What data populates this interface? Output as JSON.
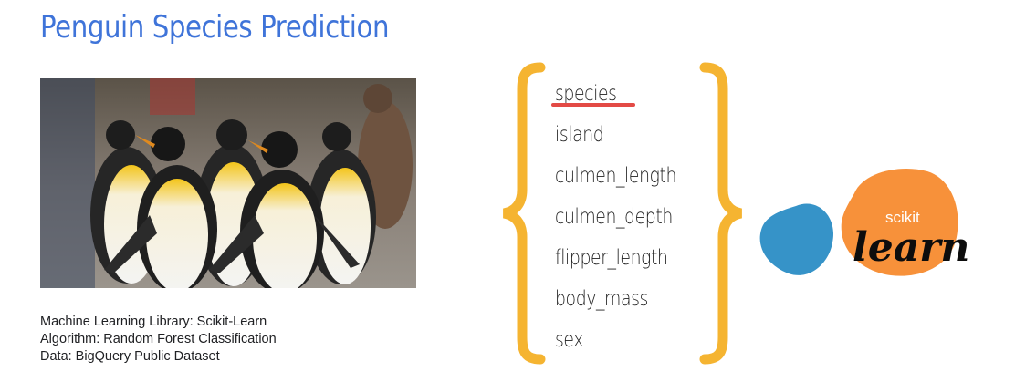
{
  "title": "Penguin Species Prediction",
  "photo": {
    "alt": "King penguins walking in a group"
  },
  "meta": {
    "library": "Machine Learning Library: Scikit-Learn",
    "algorithm": "Algorithm: Random Forest Classification",
    "data": "Data: BigQuery Public Dataset"
  },
  "features": [
    "species",
    "island",
    "culmen_length",
    "culmen_depth",
    "flipper_length",
    "body_mass",
    "sex"
  ],
  "highlighted_feature": "species",
  "logo": {
    "small": "scikit",
    "large": "learn"
  },
  "colors": {
    "title": "#3f74d9",
    "brace": "#f5b431",
    "underline": "#e34a45",
    "logo_orange": "#f7913a",
    "logo_blue": "#3693c8"
  }
}
